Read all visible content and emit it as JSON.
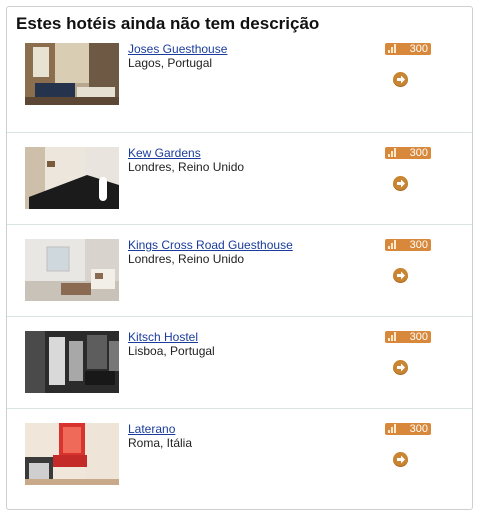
{
  "panel": {
    "title": "Estes hotéis ainda não tem descrição"
  },
  "hotels": [
    {
      "name": "Joses Guesthouse",
      "location": "Lagos, Portugal",
      "score": "300",
      "photo": "guesthouse-room"
    },
    {
      "name": "Kew Gardens",
      "location": "Londres, Reino Unido",
      "score": "300",
      "photo": "dark-bedroom"
    },
    {
      "name": "Kings Cross Road Guesthouse",
      "location": "Londres, Reino Unido",
      "score": "300",
      "photo": "bright-room"
    },
    {
      "name": "Kitsch Hostel",
      "location": "Lisboa, Portugal",
      "score": "300",
      "photo": "hostel-interior"
    },
    {
      "name": "Laterano",
      "location": "Roma, Itália",
      "score": "300",
      "photo": "red-bedroom"
    }
  ],
  "colors": {
    "badge": "#d8883a",
    "link": "#1a3c9c",
    "button": "#c98532"
  },
  "icons": {
    "badge": "signal-bars-icon",
    "button": "arrow-right-icon"
  }
}
